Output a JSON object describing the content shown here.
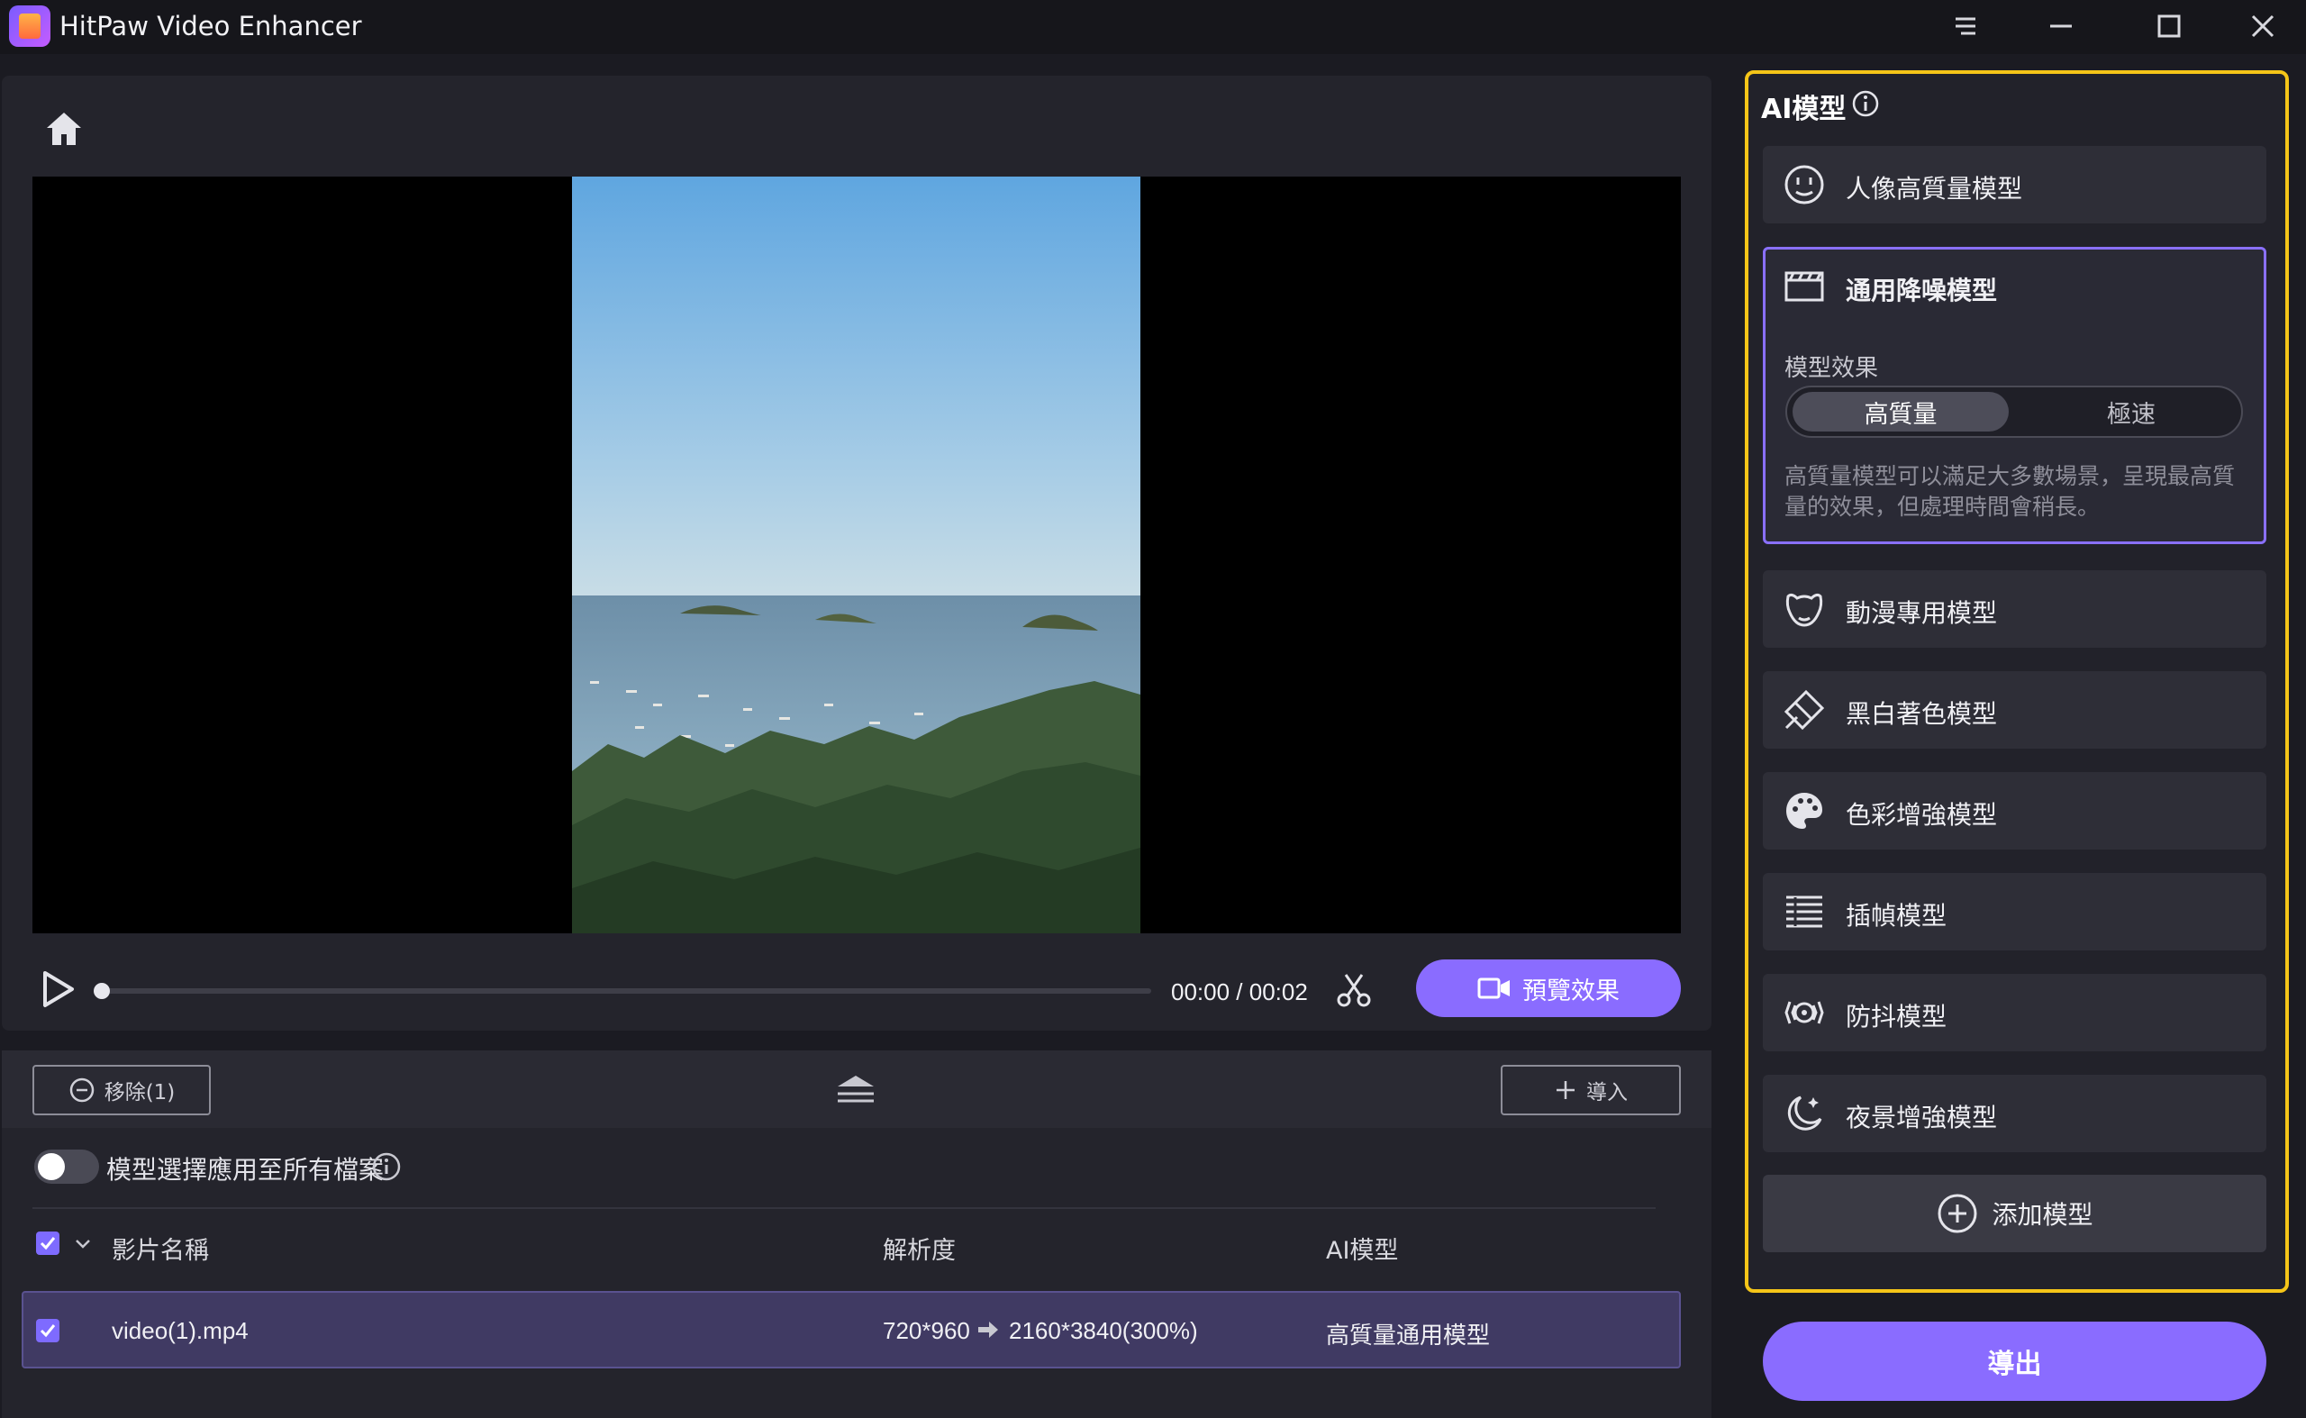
{
  "app": {
    "title": "HitPaw Video Enhancer"
  },
  "player": {
    "time": "00:00 / 00:02",
    "preview_label": "預覽效果"
  },
  "list": {
    "remove_label": "移除(1)",
    "import_label": "導入",
    "apply_all_label": "模型選擇應用至所有檔案",
    "apply_all_enabled": false,
    "columns": {
      "name": "影片名稱",
      "resolution": "解析度",
      "model": "AI模型"
    },
    "rows": [
      {
        "name": "video(1).mp4",
        "resolution_from": "720*960",
        "resolution_to": "2160*3840(300%)",
        "model": "高質量通用模型",
        "checked": true
      }
    ]
  },
  "panel": {
    "title": "AI模型",
    "models": [
      {
        "label": "人像高質量模型",
        "icon": "face-icon"
      },
      {
        "label": "通用降噪模型",
        "icon": "clapperboard-icon",
        "selected": true
      },
      {
        "label": "動漫專用模型",
        "icon": "anime-face-icon"
      },
      {
        "label": "黑白著色模型",
        "icon": "colorize-icon"
      },
      {
        "label": "色彩增強模型",
        "icon": "palette-icon"
      },
      {
        "label": "插幀模型",
        "icon": "frame-interpolation-icon"
      },
      {
        "label": "防抖模型",
        "icon": "stabilize-icon"
      },
      {
        "label": "夜景增強模型",
        "icon": "night-icon"
      }
    ],
    "effect_label": "模型效果",
    "effect_options": [
      "高質量",
      "極速"
    ],
    "effect_selected": "高質量",
    "description": "高質量模型可以滿足大多數場景，呈現最高質量的效果，但處理時間會稍長。",
    "add_model_label": "添加模型",
    "export_label": "導出"
  },
  "colors": {
    "accent": "#8a6cff",
    "highlight_border": "#f5c518"
  }
}
